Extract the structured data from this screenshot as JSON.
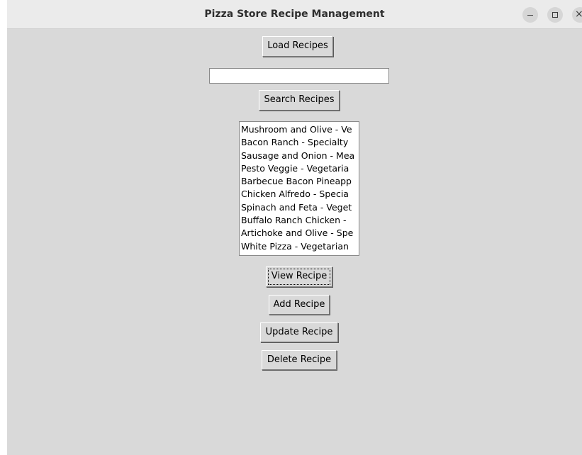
{
  "window": {
    "title": "Pizza Store Recipe Management",
    "controls": {
      "minimize": "–",
      "maximize": "□",
      "close": "×"
    }
  },
  "buttons": {
    "load": "Load Recipes",
    "search": "Search Recipes",
    "view": "View Recipe",
    "add": "Add Recipe",
    "update": "Update Recipe",
    "delete": "Delete Recipe"
  },
  "search": {
    "value": "",
    "placeholder": ""
  },
  "recipes": [
    "Mushroom and Olive - Ve",
    "Bacon Ranch - Specialty",
    "Sausage and Onion - Mea",
    "Pesto Veggie - Vegetaria",
    "Barbecue Bacon Pineapp",
    "Chicken Alfredo - Specia",
    "Spinach and Feta - Veget",
    "Buffalo Ranch Chicken -",
    "Artichoke and Olive - Spe",
    "White Pizza - Vegetarian"
  ],
  "colors": {
    "window_bg": "#d9d9d9",
    "titlebar_bg": "#ebebeb",
    "list_bg": "#ffffff"
  }
}
